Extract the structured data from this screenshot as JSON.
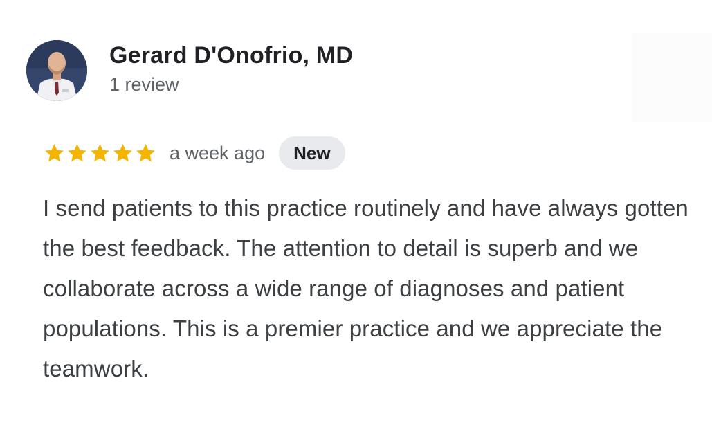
{
  "reviewer": {
    "name": "Gerard D'Onofrio, MD",
    "review_count": "1 review",
    "avatar_icon": "doctor-photo"
  },
  "review": {
    "rating": 5,
    "max_rating": 5,
    "date": "a week ago",
    "badge": "New",
    "text": "I send patients to this practice routinely and have always gotten the best feedback. The attention to detail is superb and we collaborate across a wide range of diagnoses and patient populations. This is a premier practice and we appreciate the teamwork."
  },
  "colors": {
    "star": "#f4b400",
    "badge_bg": "#e8eaed",
    "name": "#202124",
    "secondary": "#5f6368",
    "body": "#3c4043"
  }
}
